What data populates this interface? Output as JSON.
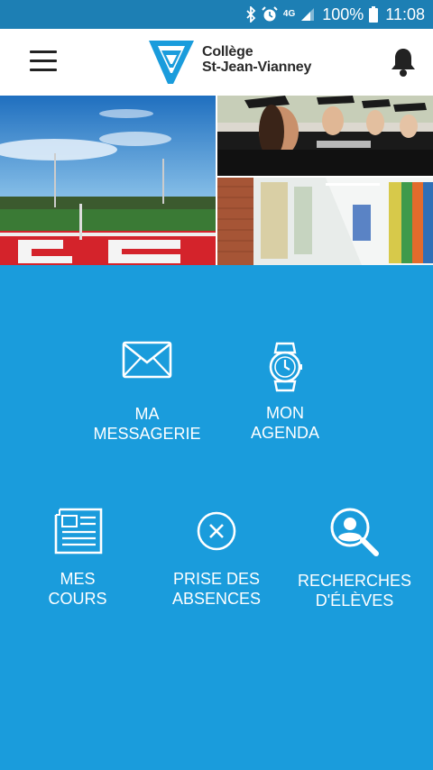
{
  "status_bar": {
    "network": "4G",
    "battery": "100%",
    "time": "11:08",
    "icons": [
      "bluetooth-icon",
      "alarm-icon",
      "signal-icon",
      "battery-icon"
    ]
  },
  "header": {
    "logo_line1": "Collège",
    "logo_line2": "St-Jean-Vianney",
    "icons": [
      "menu-icon",
      "bell-icon"
    ]
  },
  "colors": {
    "status_bar": "#1d7fb4",
    "background": "#1a9cdc",
    "brand": "#1a9cdc"
  },
  "tiles": [
    {
      "line1": "MA",
      "line2": "MESSAGERIE",
      "icon": "envelope-icon"
    },
    {
      "line1": "MON",
      "line2": "AGENDA",
      "icon": "watch-icon"
    },
    {
      "line1": "MES",
      "line2": "COURS",
      "icon": "newspaper-icon"
    },
    {
      "line1": "PRISE DES",
      "line2": "ABSENCES",
      "icon": "circle-x-icon"
    },
    {
      "line1": "RECHERCHES",
      "line2": "D'ÉLÈVES",
      "icon": "user-search-icon"
    }
  ]
}
